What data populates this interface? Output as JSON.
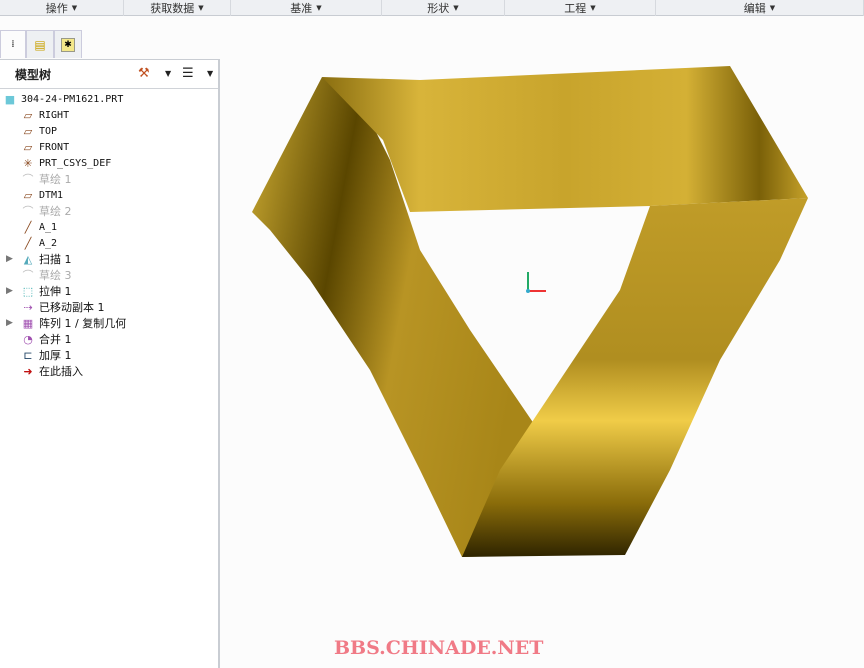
{
  "menubar": [
    {
      "label": "操作",
      "w": 124
    },
    {
      "label": "获取数据",
      "w": 107
    },
    {
      "label": "基准",
      "w": 151
    },
    {
      "label": "形状",
      "w": 123
    },
    {
      "label": "工程",
      "w": 151
    },
    {
      "label": "编辑",
      "w": 208
    }
  ],
  "tree": {
    "title": "模型树",
    "items": [
      {
        "label": "304-24-PM1621.PRT",
        "icon": "part-icon",
        "indent": 0,
        "mono": true
      },
      {
        "label": "RIGHT",
        "icon": "datum-plane-icon",
        "indent": 1,
        "mono": true
      },
      {
        "label": "TOP",
        "icon": "datum-plane-icon",
        "indent": 1,
        "mono": true
      },
      {
        "label": "FRONT",
        "icon": "datum-plane-icon",
        "indent": 1,
        "mono": true
      },
      {
        "label": "PRT_CSYS_DEF",
        "icon": "coordinate-system-icon",
        "indent": 1,
        "mono": true
      },
      {
        "label": "草绘 1",
        "icon": "sketch-icon",
        "indent": 1,
        "dim": true
      },
      {
        "label": "DTM1",
        "icon": "datum-plane-icon",
        "indent": 1,
        "mono": true
      },
      {
        "label": "草绘 2",
        "icon": "sketch-icon",
        "indent": 1,
        "dim": true
      },
      {
        "label": "A_1",
        "icon": "datum-axis-icon",
        "indent": 1,
        "mono": true
      },
      {
        "label": "A_2",
        "icon": "datum-axis-icon",
        "indent": 1,
        "mono": true
      },
      {
        "label": "扫描 1",
        "icon": "sweep-icon",
        "indent": 1,
        "expand": true
      },
      {
        "label": "草绘 3",
        "icon": "sketch-icon",
        "indent": 1,
        "dim": true
      },
      {
        "label": "拉伸 1",
        "icon": "extrude-icon",
        "indent": 1,
        "expand": true
      },
      {
        "label": "已移动副本 1",
        "icon": "moved-copy-icon",
        "indent": 1
      },
      {
        "label": "阵列 1 / 复制几何",
        "icon": "pattern-icon",
        "indent": 1,
        "expand": true
      },
      {
        "label": "合并 1",
        "icon": "merge-icon",
        "indent": 1
      },
      {
        "label": "加厚 1",
        "icon": "thicken-icon",
        "indent": 1
      },
      {
        "label": "在此插入",
        "icon": "insert-here-icon",
        "indent": 1
      }
    ]
  },
  "colors": {
    "gold": "#c9a227",
    "dark_gold": "#4a3a00",
    "watermark": "#f07a86"
  },
  "watermark": "BBS.CHINADE.NET"
}
